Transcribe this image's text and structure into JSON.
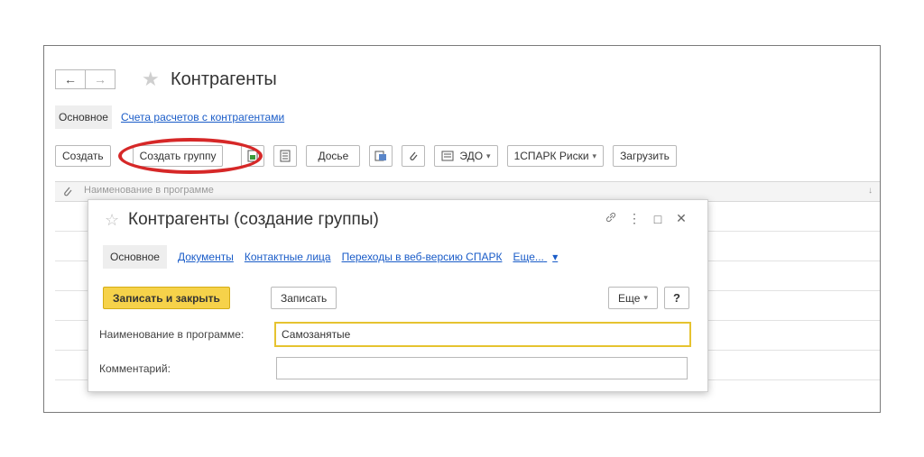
{
  "window": {
    "title": "Контрагенты",
    "nav": {
      "back_glyph": "←",
      "forward_glyph": "→"
    },
    "star_glyph": "★"
  },
  "tabs": {
    "active": "Основное",
    "link": "Счета расчетов с контрагентами"
  },
  "toolbar": {
    "create": "Создать",
    "create_group": "Создать группу",
    "dossier": "Досье",
    "edo": "ЭДО",
    "spark": "1СПАРК Риски",
    "load": "Загрузить",
    "caret": "▾"
  },
  "list": {
    "column_header": "Наименование в программе",
    "sort_glyph": "↓"
  },
  "dialog": {
    "title": "Контрагенты (создание группы)",
    "star_glyph": "☆",
    "controls": {
      "link_glyph": "🔗",
      "more_glyph": "⋮",
      "maximize_glyph": "□",
      "close_glyph": "✕"
    },
    "tabs": {
      "active": "Основное",
      "documents": "Документы",
      "contacts": "Контактные лица",
      "spark_web": "Переходы в веб-версию СПАРК",
      "more": "Еще...",
      "more_caret": "▾"
    },
    "toolbar": {
      "save_close": "Записать и закрыть",
      "save": "Записать",
      "more": "Еще",
      "more_caret": "▾",
      "help": "?"
    },
    "fields": {
      "name_label": "Наименование в программе:",
      "name_value": "Самозанятые",
      "comment_label": "Комментарий:",
      "comment_value": ""
    }
  },
  "colors": {
    "accent_link": "#1a5cc8",
    "primary_button": "#f6d24a",
    "highlight_ring": "#d62828"
  },
  "icons": [
    "back-arrow-icon",
    "forward-arrow-icon",
    "star-icon",
    "document-green-icon",
    "list-icon",
    "report-icon",
    "paperclip-icon",
    "edo-icon",
    "link-icon",
    "more-vertical-icon",
    "maximize-icon",
    "close-icon"
  ]
}
